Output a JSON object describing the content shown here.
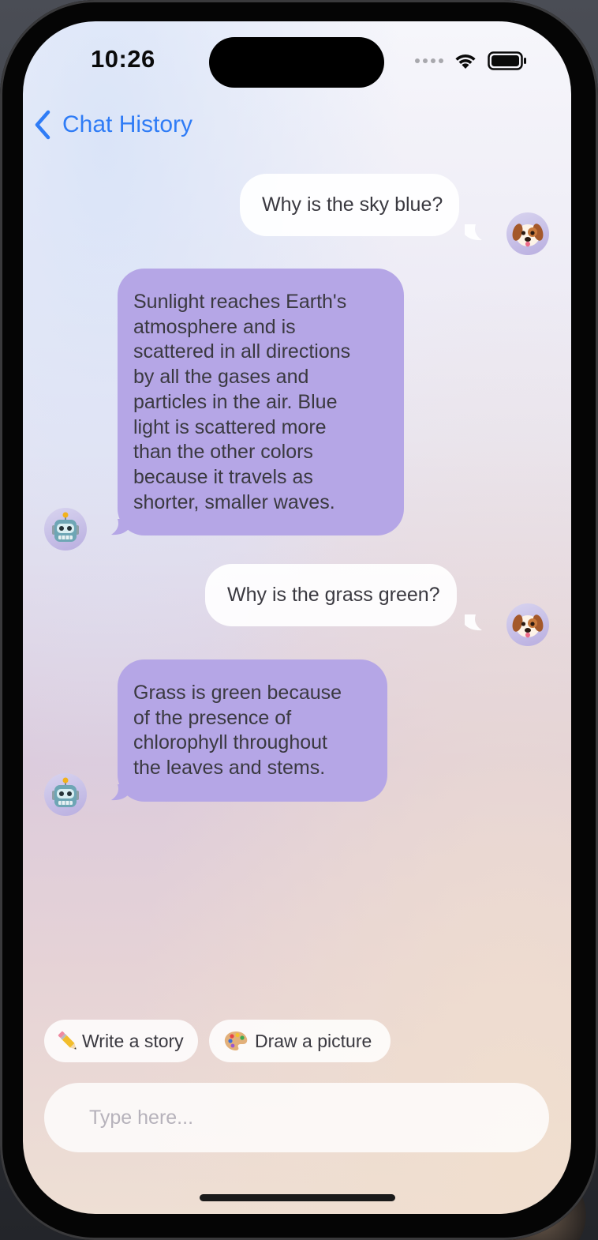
{
  "status_bar": {
    "time": "10:26"
  },
  "nav": {
    "back_label": "Chat History",
    "accent_color": "#2f7cf6"
  },
  "messages": [
    {
      "role": "user",
      "text": "Why is the sky blue?",
      "avatar": "puppy-face-icon"
    },
    {
      "role": "bot",
      "lines": [
        "Sunlight reaches Earth's",
        "atmosphere and is",
        "scattered in all directions",
        "by all the gases and",
        "particles in the air. Blue",
        "light is scattered more",
        "than the other colors",
        "because it travels as",
        "shorter, smaller waves."
      ],
      "avatar": "robot-face-icon"
    },
    {
      "role": "user",
      "text": "Why is the grass green?",
      "avatar": "puppy-face-icon"
    },
    {
      "role": "bot",
      "lines": [
        "Grass is green because",
        "of the presence of",
        "chlorophyll throughout",
        "the leaves and stems."
      ],
      "avatar": "robot-face-icon"
    }
  ],
  "suggestions": [
    {
      "icon": "pencil-icon",
      "label": "Write a story"
    },
    {
      "icon": "palette-icon",
      "label": "Draw a picture"
    }
  ],
  "composer": {
    "placeholder": "Type here...",
    "value": ""
  },
  "colors": {
    "bot_bubble": "#b5a6e6",
    "user_bubble": "#ffffff"
  }
}
